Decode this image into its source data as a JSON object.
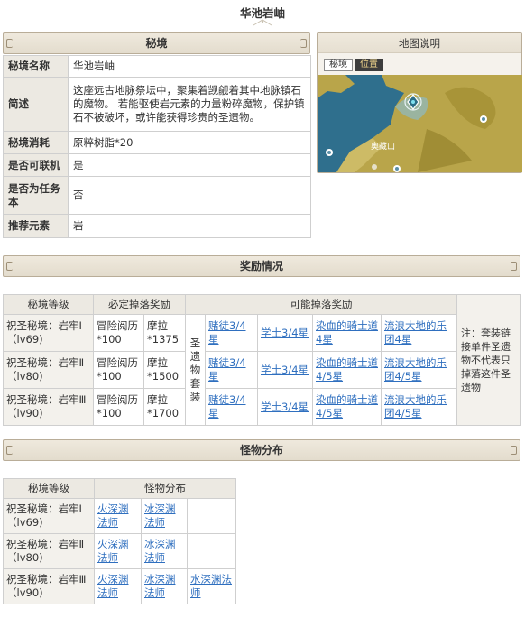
{
  "page": {
    "title": "华池岩岫"
  },
  "domain_section": {
    "header": "秘境",
    "rows": [
      {
        "key": "秘境名称",
        "value": "华池岩岫"
      },
      {
        "key": "简述",
        "value": "这座远古地脉祭坛中，聚集着觊觎着其中地脉镇石的魔物。 若能驱使岩元素的力量粉碎魔物，保护镇石不被破坏，或许能获得珍贵的圣遗物。"
      },
      {
        "key": "秘境消耗",
        "value": "原粹树脂*20"
      },
      {
        "key": "是否可联机",
        "value": "是"
      },
      {
        "key": "是否为任务本",
        "value": "否"
      },
      {
        "key": "推荐元素",
        "value": "岩"
      }
    ]
  },
  "map": {
    "header": "地图说明",
    "btn_secret": "秘境",
    "btn_position": "位置",
    "place_label": "奥藏山",
    "colors": {
      "water": "#2f6f8d",
      "land": "#b9a54a",
      "land_dark": "#8d7a2c"
    }
  },
  "rewards_section": {
    "header": "奖励情况",
    "columns": {
      "tier": "秘境等级",
      "fixed": "必定掉落奖励",
      "possible": "可能掉落奖励"
    },
    "set_label": "圣遗物套装",
    "note": "注：套装链接单件圣遗物不代表只掉落这件圣遗物",
    "rows": [
      {
        "tier": "祝圣秘境：岩牢Ⅰ（lv69)",
        "exp": "冒险阅历*100",
        "mora": "摩拉*1375",
        "sets": [
          "赌徒3/4星",
          "学士3/4星",
          "染血的骑士道4星",
          "流浪大地的乐团4星"
        ]
      },
      {
        "tier": "祝圣秘境：岩牢Ⅱ（lv80)",
        "exp": "冒险阅历*100",
        "mora": "摩拉*1500",
        "sets": [
          "赌徒3/4星",
          "学士3/4星",
          "染血的骑士道4/5星",
          "流浪大地的乐团4/5星"
        ]
      },
      {
        "tier": "祝圣秘境：岩牢Ⅲ（lv90)",
        "exp": "冒险阅历*100",
        "mora": "摩拉*1700",
        "sets": [
          "赌徒3/4星",
          "学士3/4星",
          "染血的骑士道4/5星",
          "流浪大地的乐团4/5星"
        ]
      }
    ]
  },
  "monsters_section": {
    "header": "怪物分布",
    "columns": {
      "tier": "秘境等级",
      "monsters": "怪物分布"
    },
    "rows": [
      {
        "tier": "祝圣秘境：岩牢Ⅰ（lv69)",
        "monsters": [
          "火深渊法师",
          "冰深渊法师"
        ]
      },
      {
        "tier": "祝圣秘境：岩牢Ⅱ（lv80)",
        "monsters": [
          "火深渊法师",
          "冰深渊法师"
        ]
      },
      {
        "tier": "祝圣秘境：岩牢Ⅲ（lv90)",
        "monsters": [
          "火深渊法师",
          "冰深渊法师",
          "水深渊法师"
        ]
      }
    ]
  }
}
